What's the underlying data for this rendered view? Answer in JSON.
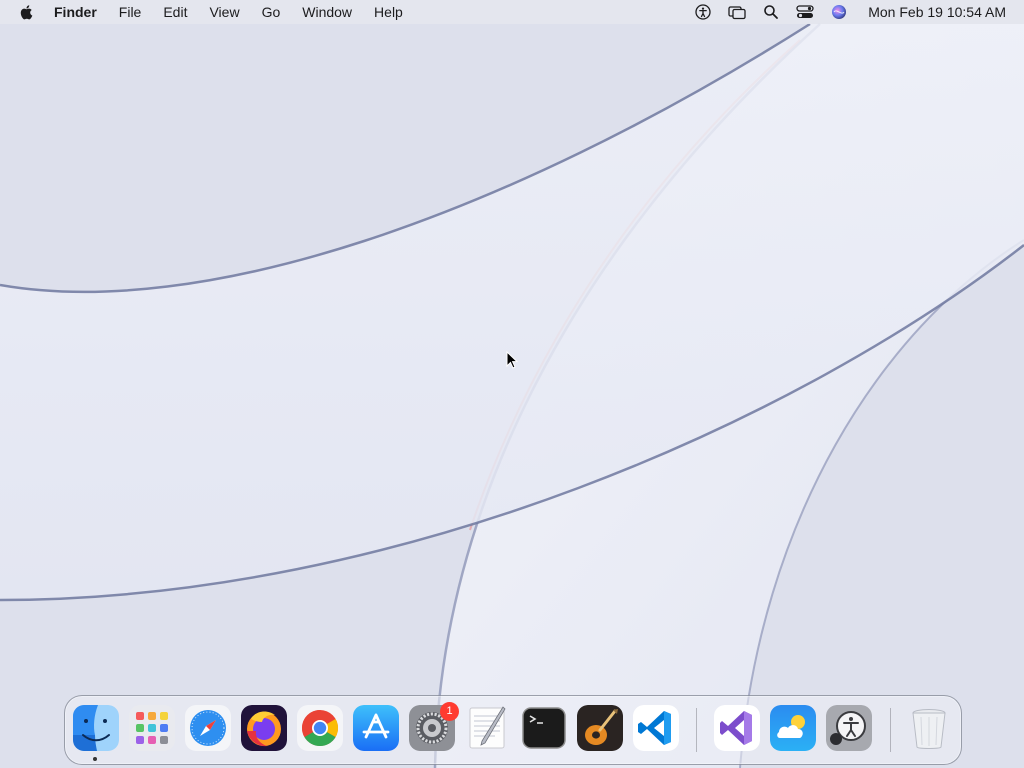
{
  "menubar": {
    "app_name": "Finder",
    "menus": [
      "File",
      "Edit",
      "View",
      "Go",
      "Window",
      "Help"
    ],
    "clock": "Mon Feb 19  10:54 AM",
    "status_icons": [
      "accessibility-icon",
      "screen-mirroring-icon",
      "spotlight-search-icon",
      "control-center-icon",
      "siri-icon"
    ]
  },
  "dock": {
    "apps": [
      {
        "name": "Finder",
        "icon": "finder-icon",
        "running": true
      },
      {
        "name": "Launchpad",
        "icon": "launchpad-icon"
      },
      {
        "name": "Safari",
        "icon": "safari-icon"
      },
      {
        "name": "Firefox",
        "icon": "firefox-icon"
      },
      {
        "name": "Google Chrome",
        "icon": "chrome-icon"
      },
      {
        "name": "App Store",
        "icon": "app-store-icon"
      },
      {
        "name": "System Settings",
        "icon": "system-settings-icon",
        "badge": "1"
      },
      {
        "name": "TextEdit",
        "icon": "textedit-icon"
      },
      {
        "name": "Terminal",
        "icon": "terminal-icon"
      },
      {
        "name": "GarageBand",
        "icon": "garageband-icon"
      },
      {
        "name": "Visual Studio Code",
        "icon": "vscode-icon"
      },
      {
        "name": "Visual Studio",
        "icon": "visual-studio-icon"
      },
      {
        "name": "Weather",
        "icon": "weather-icon"
      },
      {
        "name": "Accessibility Inspector",
        "icon": "accessibility-inspector-icon"
      },
      {
        "name": "Trash",
        "icon": "trash-icon"
      }
    ]
  },
  "colors": {
    "badge": "#ff3b30",
    "vscode_blue": "#0078d4",
    "visual_studio_purple": "#7c4dcc",
    "terminal_bg": "#1b1b1b"
  }
}
